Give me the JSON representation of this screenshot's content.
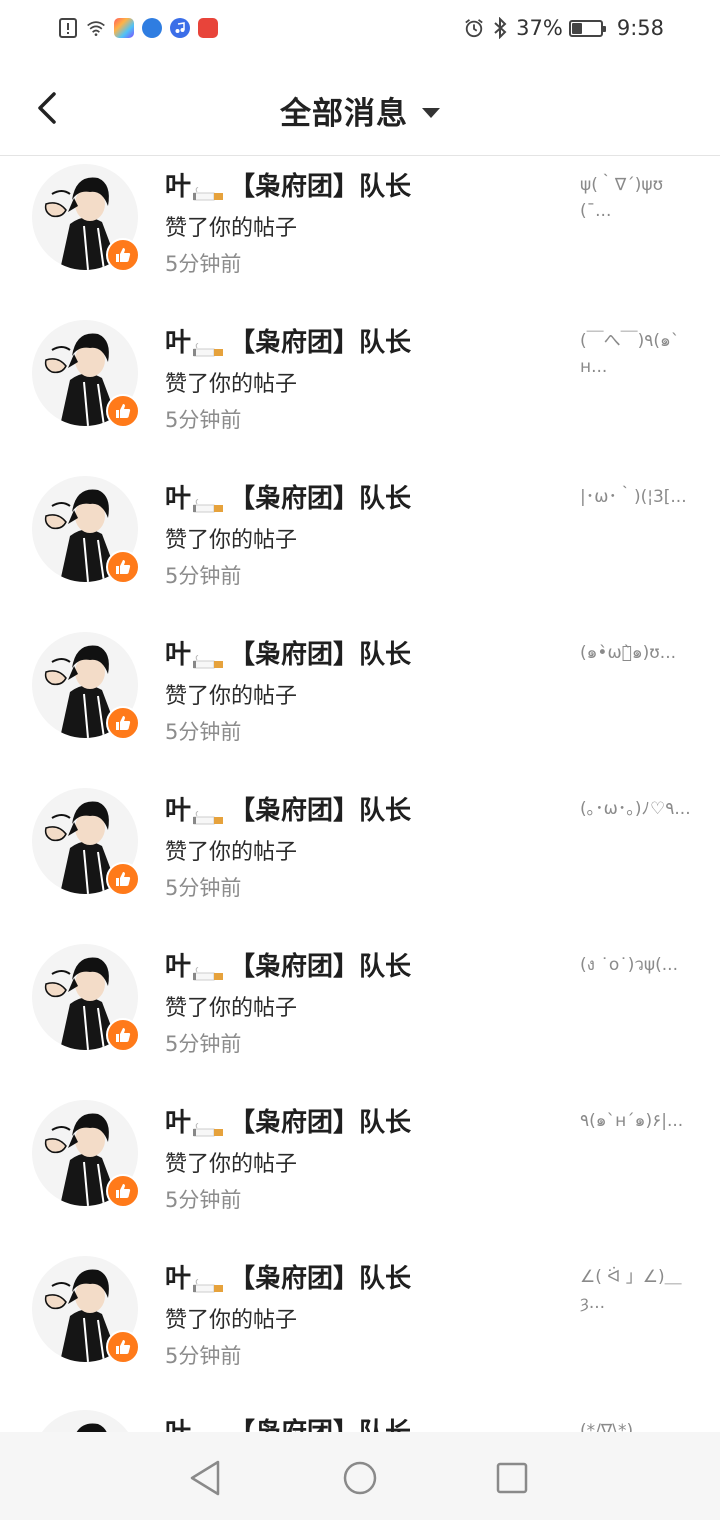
{
  "status_bar": {
    "time": "9:58",
    "battery": "37%",
    "battery_level": 0.37,
    "app_icons": [
      "alert-icon",
      "wifi-icon",
      "app-icon-colorful",
      "app-icon-blue",
      "music-app-icon",
      "app-icon-red"
    ],
    "right_icons": [
      "alarm-icon",
      "bluetooth-icon",
      "battery-icon"
    ]
  },
  "header": {
    "title": "全部消息",
    "back_icon": "back-arrow-icon",
    "dropdown_icon": "caret-down-icon"
  },
  "messages": [
    {
      "name_pre": "叶",
      "name_post": "【枭府团】队长",
      "action": "赞了你的帖子",
      "time": "5分钟前",
      "preview": "ψ(｀∇´)ψʊ(¯..."
    },
    {
      "name_pre": "叶",
      "name_post": "【枭府团】队长",
      "action": "赞了你的帖子",
      "time": "5分钟前",
      "preview": "(￣へ￣)٩(๑`н..."
    },
    {
      "name_pre": "叶",
      "name_post": "【枭府团】队长",
      "action": "赞了你的帖子",
      "time": "5分钟前",
      "preview": "|･ω･｀)(¦3[..."
    },
    {
      "name_pre": "叶",
      "name_post": "【枭府团】队长",
      "action": "赞了你的帖子",
      "time": "5分钟前",
      "preview": "(๑•̀ωก̀๑)ʊ..."
    },
    {
      "name_pre": "叶",
      "name_post": "【枭府团】队长",
      "action": "赞了你的帖子",
      "time": "5分钟前",
      "preview": "(｡･ω･｡)ﾉ♡٩..."
    },
    {
      "name_pre": "叶",
      "name_post": "【枭府团】队长",
      "action": "赞了你的帖子",
      "time": "5分钟前",
      "preview": "(ง ˙o˙)วψ(..."
    },
    {
      "name_pre": "叶",
      "name_post": "【枭府团】队长",
      "action": "赞了你的帖子",
      "time": "5分钟前",
      "preview": "٩(๑`н´๑)۶|..."
    },
    {
      "name_pre": "叶",
      "name_post": "【枭府团】队长",
      "action": "赞了你的帖子",
      "time": "5分钟前",
      "preview": "∠( ᐛ 」∠)＿ȝ..."
    },
    {
      "name_pre": "叶",
      "name_post": "【枭府团】队长",
      "action": "",
      "time": "",
      "preview": "(*/∇\\*)"
    }
  ],
  "colors": {
    "accent": "#ff7a1a",
    "name_text": "#1f1f1f",
    "time_text": "#8c8c8c",
    "preview_text": "#8a8a8a",
    "divider": "#e4e4e4",
    "nav_bg": "#f6f6f6"
  },
  "nav": {
    "back": "nav-back-icon",
    "home": "nav-home-icon",
    "recents": "nav-recents-icon"
  }
}
